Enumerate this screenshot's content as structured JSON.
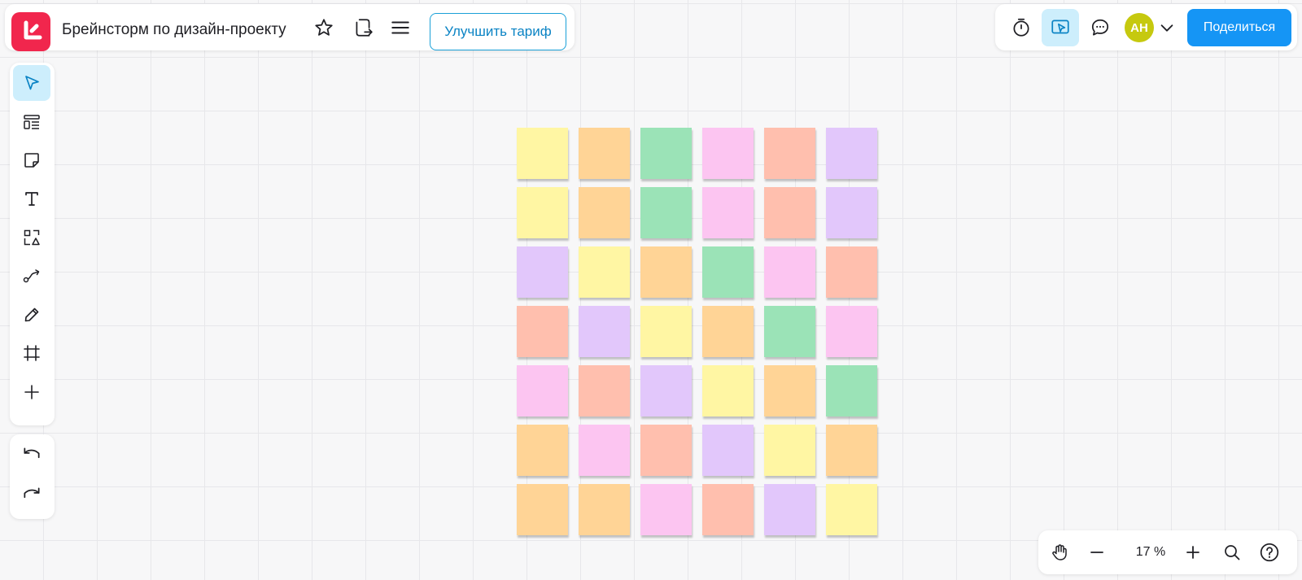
{
  "header": {
    "board_title": "Брейнсторм по дизайн-проекту",
    "upgrade_label": "Улучшить тариф",
    "share_label": "Поделиться",
    "avatar_initials": "АН"
  },
  "icons": {
    "logo": "app-logo-icon",
    "favorite": "star-icon",
    "export": "export-board-icon",
    "menu": "hamburger-menu-icon",
    "timer": "timer-icon",
    "presentation": "presentation-cursor-icon",
    "comments": "comments-icon",
    "account_menu": "chevron-down-icon"
  },
  "tools": [
    {
      "name": "select",
      "icon": "cursor-icon",
      "active": true
    },
    {
      "name": "templates",
      "icon": "templates-icon"
    },
    {
      "name": "sticky-note",
      "icon": "sticky-note-icon"
    },
    {
      "name": "text",
      "icon": "text-icon"
    },
    {
      "name": "shapes",
      "icon": "shapes-icon"
    },
    {
      "name": "connector",
      "icon": "connector-icon"
    },
    {
      "name": "pen",
      "icon": "pen-icon"
    },
    {
      "name": "frame",
      "icon": "frame-icon"
    },
    {
      "name": "more",
      "icon": "plus-icon"
    }
  ],
  "history": [
    {
      "name": "undo",
      "icon": "undo-icon"
    },
    {
      "name": "redo",
      "icon": "redo-icon"
    }
  ],
  "zoom": {
    "level": "17 %",
    "icons": [
      "hand-icon",
      "zoom-out-icon",
      "zoom-in-icon",
      "fit-to-screen-icon",
      "help-icon"
    ]
  },
  "palette": {
    "yellow": "#fff6a3",
    "orange": "#ffd496",
    "green": "#9be3b7",
    "pink": "#fcc5f1",
    "coral": "#ffbfae",
    "purple": "#e2c7fb"
  },
  "sticky_grid": [
    [
      "yellow",
      "orange",
      "green",
      "pink",
      "coral",
      "purple"
    ],
    [
      "yellow",
      "orange",
      "green",
      "pink",
      "coral",
      "purple"
    ],
    [
      "purple",
      "yellow",
      "orange",
      "green",
      "pink",
      "coral"
    ],
    [
      "coral",
      "purple",
      "yellow",
      "orange",
      "green",
      "pink"
    ],
    [
      "pink",
      "coral",
      "purple",
      "yellow",
      "orange",
      "green"
    ],
    [
      "orange",
      "pink",
      "coral",
      "purple",
      "yellow",
      "orange"
    ],
    [
      "orange",
      "orange",
      "pink",
      "coral",
      "purple",
      "yellow"
    ]
  ]
}
